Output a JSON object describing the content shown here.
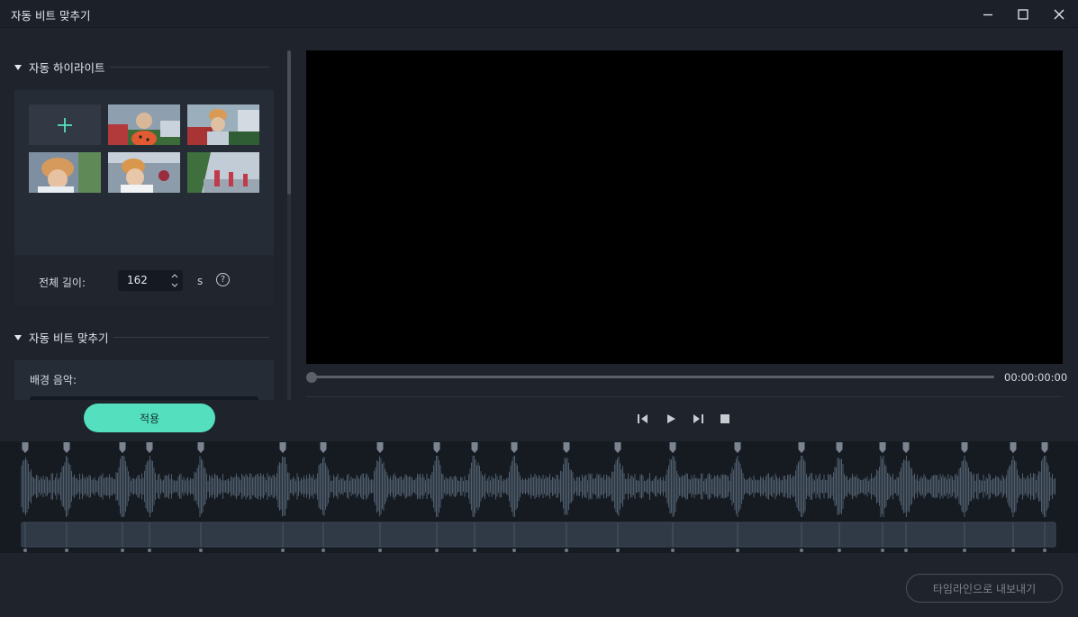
{
  "window": {
    "title": "자동 비트 맞추기"
  },
  "highlights": {
    "section_title": "자동 하이라이트",
    "add_icon": "plus-icon",
    "total_length_label": "전체 길이:",
    "total_length_value": "162",
    "total_length_unit": "s",
    "help_glyph": "?"
  },
  "beat_sync": {
    "section_title": "자동 비트 맞추기",
    "background_music_label": "배경 음악:"
  },
  "apply_button": "적용",
  "player": {
    "timecode": "00:00:00:00",
    "progress": 0
  },
  "export_button": "타임라인으로 내보내기",
  "colors": {
    "accent": "#54e0bf",
    "background": "#1e232c",
    "timeline_bg": "#161b22",
    "waveform": "#4f5d6c"
  }
}
